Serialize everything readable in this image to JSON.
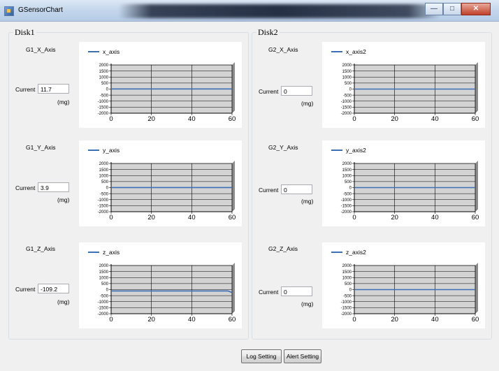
{
  "window": {
    "title": "GSensorChart",
    "minimize": "—",
    "maximize": "□",
    "close": "✕"
  },
  "disks": [
    {
      "title": "Disk1",
      "panels": [
        {
          "axis_label": "G1_X_Axis",
          "current_label": "Current",
          "value": "11.7",
          "unit": "(mg)",
          "legend": "x_axis"
        },
        {
          "axis_label": "G1_Y_Axis",
          "current_label": "Current",
          "value": "3.9",
          "unit": "(mg)",
          "legend": "y_axis"
        },
        {
          "axis_label": "G1_Z_Axis",
          "current_label": "Current",
          "value": "-109.2",
          "unit": "(mg)",
          "legend": "z_axis"
        }
      ]
    },
    {
      "title": "Disk2",
      "panels": [
        {
          "axis_label": "G2_X_Axis",
          "current_label": "Current",
          "value": "0",
          "unit": "(mg)",
          "legend": "x_axis2"
        },
        {
          "axis_label": "G2_Y_Axis",
          "current_label": "Current",
          "value": "0",
          "unit": "(mg)",
          "legend": "y_axis2"
        },
        {
          "axis_label": "G2_Z_Axis",
          "current_label": "Current",
          "value": "0",
          "unit": "(mg)",
          "legend": "z_axis2"
        }
      ]
    }
  ],
  "buttons": {
    "log_setting": "Log Setting",
    "alert_setting": "Alert Setting"
  },
  "chart_data": [
    {
      "type": "line",
      "series": [
        {
          "name": "x_axis",
          "x": [
            0,
            60
          ],
          "y": [
            11.7,
            11.7
          ]
        }
      ],
      "ylim": [
        -2000,
        2000
      ],
      "xlim": [
        0,
        60
      ],
      "xticks": [
        "0",
        "20",
        "40",
        "60"
      ],
      "yticks": [
        "2000",
        "1500",
        "1000",
        "500",
        "0",
        "-500",
        "-1000",
        "-1500",
        "-2000"
      ],
      "grid": true,
      "legend": "top-left",
      "color": "#3d6fb6"
    },
    {
      "type": "line",
      "series": [
        {
          "name": "y_axis",
          "x": [
            0,
            60
          ],
          "y": [
            3.9,
            3.9
          ]
        }
      ],
      "ylim": [
        -2000,
        2000
      ],
      "xlim": [
        0,
        60
      ],
      "xticks": [
        "0",
        "20",
        "40",
        "60"
      ],
      "yticks": [
        "2000",
        "1500",
        "1000",
        "500",
        "0",
        "-500",
        "-1000",
        "-1500",
        "-2000"
      ],
      "grid": true,
      "legend": "top-left",
      "color": "#3d6fb6"
    },
    {
      "type": "line",
      "series": [
        {
          "name": "z_axis",
          "x": [
            0,
            58,
            60
          ],
          "y": [
            -109.2,
            -109.2,
            -250
          ]
        }
      ],
      "ylim": [
        -2000,
        2000
      ],
      "xlim": [
        0,
        60
      ],
      "xticks": [
        "0",
        "20",
        "40",
        "60"
      ],
      "yticks": [
        "2000",
        "1500",
        "1000",
        "500",
        "0",
        "-500",
        "-1000",
        "-1500",
        "-2000"
      ],
      "grid": true,
      "legend": "top-left",
      "color": "#3d6fb6"
    },
    {
      "type": "line",
      "series": [
        {
          "name": "x_axis2",
          "x": [
            0,
            60
          ],
          "y": [
            0,
            0
          ]
        }
      ],
      "ylim": [
        -2000,
        2000
      ],
      "xlim": [
        0,
        60
      ],
      "xticks": [
        "0",
        "20",
        "40",
        "60"
      ],
      "yticks": [
        "2000",
        "1500",
        "1000",
        "500",
        "0",
        "-500",
        "-1000",
        "-1500",
        "-2000"
      ],
      "grid": true,
      "legend": "top-left",
      "color": "#3d6fb6"
    },
    {
      "type": "line",
      "series": [
        {
          "name": "y_axis2",
          "x": [
            0,
            60
          ],
          "y": [
            0,
            0
          ]
        }
      ],
      "ylim": [
        -2000,
        2000
      ],
      "xlim": [
        0,
        60
      ],
      "xticks": [
        "0",
        "20",
        "40",
        "60"
      ],
      "yticks": [
        "2000",
        "1500",
        "1000",
        "500",
        "0",
        "-500",
        "-1000",
        "-1500",
        "-2000"
      ],
      "grid": true,
      "legend": "top-left",
      "color": "#3d6fb6"
    },
    {
      "type": "line",
      "series": [
        {
          "name": "z_axis2",
          "x": [
            0,
            60
          ],
          "y": [
            0,
            0
          ]
        }
      ],
      "ylim": [
        -2000,
        2000
      ],
      "xlim": [
        0,
        60
      ],
      "xticks": [
        "0",
        "20",
        "40",
        "60"
      ],
      "yticks": [
        "2000",
        "1500",
        "1000",
        "500",
        "0",
        "-500",
        "-1000",
        "-1500",
        "-2000"
      ],
      "grid": true,
      "legend": "top-left",
      "color": "#3d6fb6"
    }
  ]
}
